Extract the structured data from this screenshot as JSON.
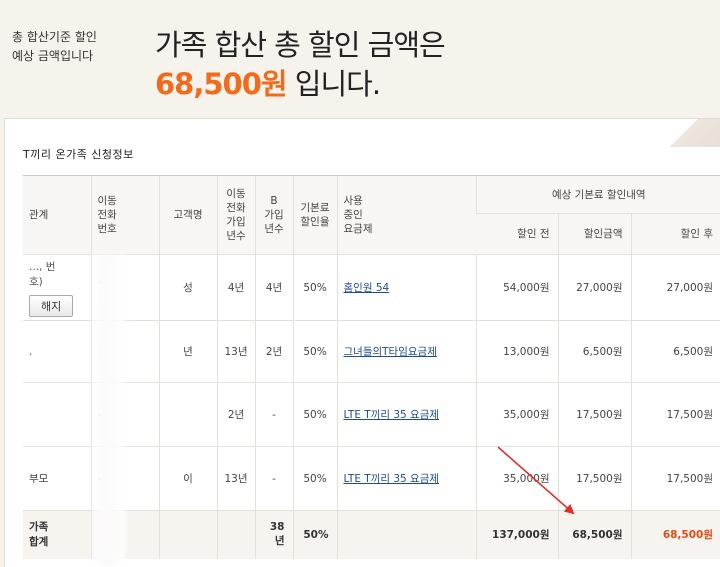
{
  "banner": {
    "side_note_line1": "총 합산기준 할인",
    "side_note_line2": "예상 금액입니다",
    "headline_line1": "가족 합산 총 할인 금액은",
    "headline_amount": "68,500원",
    "headline_suffix": " 입니다."
  },
  "panel": {
    "title": "T끼리 온가족 신청정보"
  },
  "table": {
    "headers": {
      "relation": "관계",
      "mobile_number": "이동\n전화\n번호",
      "customer_name": "고객명",
      "mobile_years": "이동\n전화\n가입\n년수",
      "b_years": "B\n가입\n년수",
      "base_discount_rate": "기본료\n할인율",
      "current_plan": "사용\n중인\n요금제",
      "expected_group": "예상 기본료 할인내역",
      "before_discount": "할인 전",
      "discount_amount": "할인금액",
      "after_discount": "할인 후"
    },
    "rows": [
      {
        "relation": "..., 번\n호)",
        "cancel_label": "해지",
        "phone": "- ·\n:",
        "name": "성",
        "mobile_years": "4년",
        "b_years": "4년",
        "rate": "50%",
        "plan": "홈인원 54",
        "before": "54,000원",
        "discount": "27,000원",
        "after": "27,000원"
      },
      {
        "relation": ".",
        "cancel_label": "",
        "phone": "-",
        "name": "년",
        "mobile_years": "13년",
        "b_years": "2년",
        "rate": "50%",
        "plan": "그녀들의T타임요금제",
        "before": "13,000원",
        "discount": "6,500원",
        "after": "6,500원"
      },
      {
        "relation": "",
        "cancel_label": "",
        "phone": "-",
        "name": "",
        "mobile_years": "2년",
        "b_years": "-",
        "rate": "50%",
        "plan": "LTE T끼리 35 요금제",
        "before": "35,000원",
        "discount": "17,500원",
        "after": "17,500원"
      },
      {
        "relation": "부모",
        "cancel_label": "",
        "phone": "-",
        "name": "이",
        "mobile_years": "13년",
        "b_years": "-",
        "rate": "50%",
        "plan": "LTE T끼리 35 요금제",
        "before": "35,000원",
        "discount": "17,500원",
        "after": "17,500원"
      }
    ],
    "total": {
      "label": "가족\n합계",
      "b_years": "38년",
      "rate": "50%",
      "before": "137,000원",
      "discount": "68,500원",
      "after": "68,500원"
    }
  },
  "colors": {
    "accent_orange": "#f26a1b",
    "total_red": "#e24b12",
    "link_blue": "#1b4d8f",
    "arrow_red": "#e0302a"
  }
}
